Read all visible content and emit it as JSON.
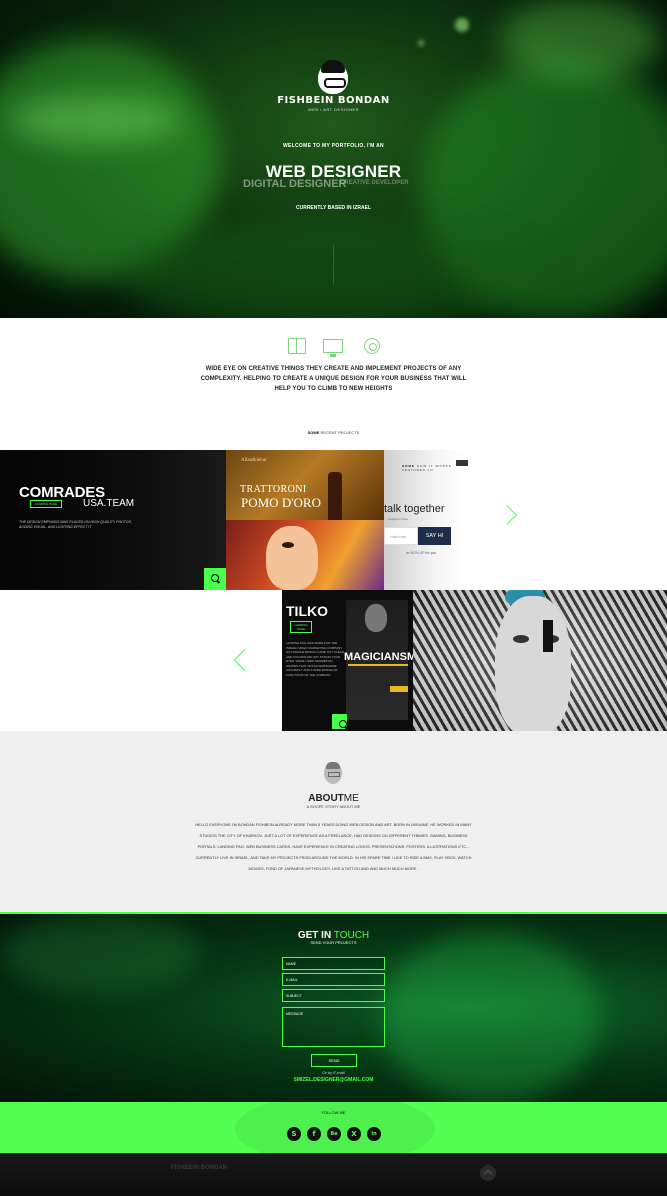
{
  "hero": {
    "logo_name": "FISHBEIN BONDAN",
    "logo_sub": "WEB / ART DESIGNER",
    "welcome": "WELCOME TO MY PORTFOLIO, I'M AN",
    "title": "WEB DESIGNER",
    "alt_title_1": "DIGITAL DESIGNER",
    "alt_title_2": "CREATIVE DEVELOPER",
    "based": "CURRENTLY BASED IN IZRAEL"
  },
  "services": {
    "icons": [
      "book-icon",
      "monitor-icon",
      "gear-icon"
    ],
    "text": "WIDE EYE ON CREATIVE THINGS THEY CREATE AND IMPLEMENT PROJECTS OF ANY COMPLEXITY. HELPING TO CREATE A UNIQUE DESIGN FOR YOUR BUSINESS THAT WILL HELP YOU TO CLIMB TO NEW HEIGHTS"
  },
  "projects": {
    "head_bold": "SOME",
    "head_rest": " RECENT PROJECTS",
    "comrades": {
      "title": "COMRADES",
      "tag": "LANDING PAGE",
      "site": "USA.TEAM",
      "desc": "THE DESIGN EMPHASIS WAS PLACED ON HIGH QUALITY PHOTOS, ADDING VISUAL, AND LIGHTING EFFECT IT"
    },
    "pomo": {
      "brand": "Allan&Jebur",
      "line1": "TRATTORONI",
      "line2": "POMO D'ORO"
    },
    "talk": {
      "nav_home": "HOME",
      "nav_rest": "HOW IT WORKS   FEATURES   LO",
      "title": "talk together",
      "free": "...people for free",
      "email_placeholder": "...mail.com",
      "button": "SAY HI",
      "or_text": "or ",
      "signup": "SIGN UP",
      "signup_rest": " for you"
    },
    "tilko": {
      "title": "TILKO",
      "tag": "LANDING PAGE",
      "desc": "LANDING PAG WAS MADE FOR THE ISRAELI VIDEO MARKETING COMPANY ICI A WHOLE DESIGN CAME OUT CLEAN AND COLORS DID NOT STRAIN YOUR EYES. WERE USED GEOMETRIC SHAPES THAT WOULD EMPHASIZE ACCURACY AND A WIDE RANGE OF FUNCTIONS OF THE COMPANY",
      "magic": "MAGICIANSM"
    },
    "nav_next": "›",
    "nav_prev": "‹"
  },
  "about": {
    "title_bold": "ABOUT",
    "title_rest": "ME",
    "sub": "A SHORT STORY ABOUT ME",
    "body": "HELLO EVERYONE I'M BOHDAN FISHBEIN ALREADY MORE THAN 5 YEARS DOING WEB DESIGN AND ART. BORN IN UKRAINE, HE WORKED IN MANY STUDIOS THE CITY OF KHARKOV. JUST A LOT OF EXPERIENCE AS A FREELANCE, HAD DESIGNS ON DIFFERENT THEMES: GAMING, BUSINESS PORTALS, LANDING PAG, WEB BUSINESS CARDS. HAVE EXPERIENCE IN CREATING LOGOS, PRESENTATIONS, POSTERS, ILLUSTRATIONS ETC... CURRENTLY LIVE IN ISRAEL, AND TAKE MY PROJECTS FROM AROUND THE WORLD. IN HIS SPARE TIME I LIKE TO RIDE A BMX, PLAY XBOX, WATCH MOVIES, FOND OF JAPANESE MYTHOLOGY, LIKE A TATTOO AND AND MUCH MUCH MORE ."
  },
  "contact": {
    "title_bold": "GET IN",
    "title_rest": " TOUCH",
    "sub": "SEND YOUR PROJECTS",
    "name_placeholder": "NAME",
    "email_placeholder": "E-MAIL",
    "subject_placeholder": "SUBJECT",
    "message_placeholder": "MESSAGE",
    "send": "SEND",
    "or_email": "Or by E-mail",
    "email": "SMIZEL.DESIGNER@GMAIL.COM"
  },
  "follow": {
    "title": "FOLLOW ME",
    "icons": [
      "skype-icon",
      "facebook-icon",
      "behance-icon",
      "xing-icon",
      "linkedin-icon"
    ],
    "glyphs": [
      "S",
      "f",
      "Be",
      "X",
      "in"
    ]
  },
  "footer": {
    "logo": "FISHBEIN BONDAN"
  },
  "colors": {
    "accent": "#49ff49",
    "follow_bar": "#52ff52",
    "dark": "#111111"
  }
}
